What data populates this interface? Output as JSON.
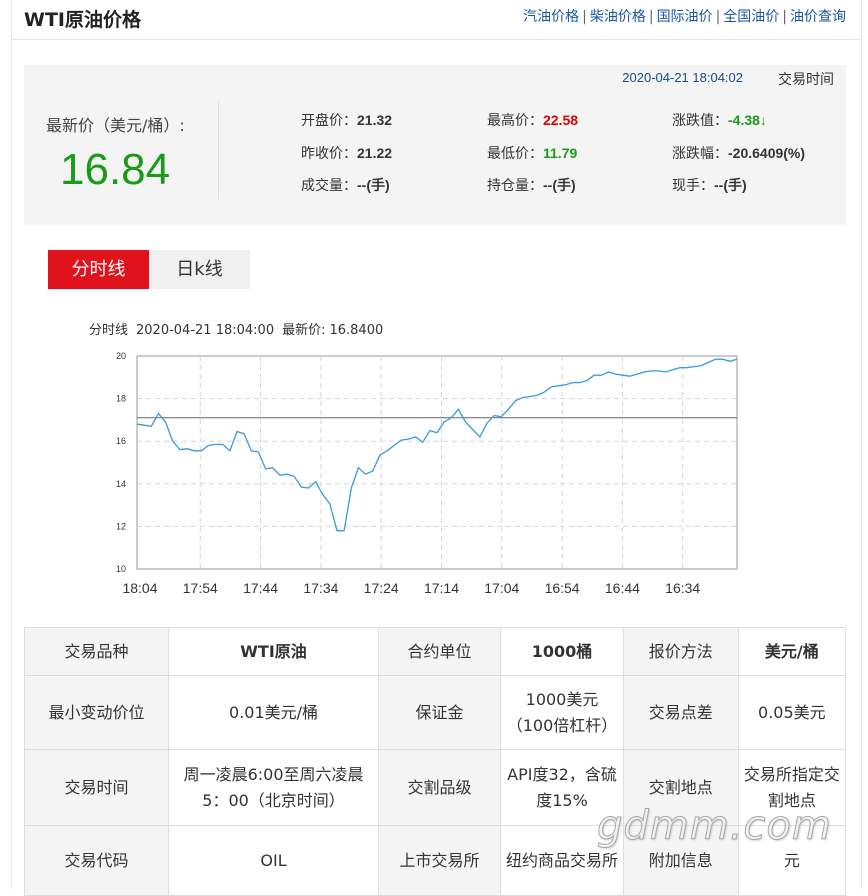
{
  "header": {
    "title": "WTI原油价格",
    "links": [
      "汽油价格",
      "柴油价格",
      "国际油价",
      "全国油价",
      "油价查询"
    ]
  },
  "quote": {
    "datetime": "2020-04-21 18:04:02",
    "time_label": "交易时间",
    "last_label": "最新价（美元/桶）:",
    "last_value": "16.84",
    "stats": {
      "open_label": "开盘价：",
      "open": "21.32",
      "high_label": "最高价：",
      "high": "22.58",
      "change_label": "涨跌值：",
      "change": "-4.38↓",
      "prev_label": "昨收价：",
      "prev": "21.22",
      "low_label": "最低价：",
      "low": "11.79",
      "pct_label": "涨跌幅：",
      "pct": "-20.6409(%)",
      "volume_label": "成交量：",
      "volume": "--(手)",
      "oi_label": "持仓量：",
      "oi": "--(手)",
      "spot_label": "现手：",
      "spot": "--(手)"
    },
    "colors": {
      "up": "#e00000",
      "down": "#1a9a1a"
    }
  },
  "tabs": {
    "intraday": "分时线",
    "daily": "日k线"
  },
  "chart_info": {
    "type_label": "分时线",
    "datetime": "2020-04-21 18:04:00",
    "last_label": "最新价:",
    "last_value": "16.8400"
  },
  "chart_data": {
    "type": "line",
    "title": "",
    "xlabel": "",
    "ylabel": "",
    "x_ticks": [
      "18:04",
      "17:54",
      "17:44",
      "17:34",
      "17:24",
      "17:14",
      "17:04",
      "16:54",
      "16:44",
      "16:34"
    ],
    "ylim": [
      10,
      20
    ],
    "y_ticks": [
      "10",
      "12",
      "14",
      "16",
      "18",
      "20"
    ],
    "reference_line": 17.1,
    "grid": true,
    "series": [
      {
        "values": [
          16.8,
          16.75,
          16.7,
          17.3,
          16.9,
          16.0,
          15.6,
          15.65,
          15.55,
          15.55,
          15.8,
          15.85,
          15.85,
          15.55,
          16.45,
          16.35,
          15.55,
          15.5,
          14.7,
          14.75,
          14.4,
          14.45,
          14.35,
          13.85,
          13.8,
          14.1,
          13.5,
          13.05,
          11.8,
          11.8,
          13.8,
          14.75,
          14.45,
          14.6,
          15.35,
          15.55,
          15.8,
          16.05,
          16.1,
          16.2,
          15.95,
          16.5,
          16.4,
          16.9,
          17.1,
          17.5,
          16.9,
          16.55,
          16.2,
          16.85,
          17.2,
          17.15,
          17.5,
          17.9,
          18.05,
          18.1,
          18.15,
          18.3,
          18.55,
          18.6,
          18.65,
          18.75,
          18.75,
          18.85,
          19.1,
          19.1,
          19.25,
          19.15,
          19.1,
          19.05,
          19.15,
          19.25,
          19.3,
          19.3,
          19.25,
          19.35,
          19.45,
          19.45,
          19.5,
          19.55,
          19.7,
          19.85,
          19.85,
          19.75,
          19.85
        ]
      }
    ]
  },
  "table": [
    [
      {
        "t": "交易品种",
        "h": true
      },
      {
        "t": "WTI原油",
        "b": true
      },
      {
        "t": "合约单位",
        "h": true
      },
      {
        "t": "1000桶",
        "b": true
      },
      {
        "t": "报价方法",
        "h": true
      },
      {
        "t": "美元/桶",
        "b": true
      }
    ],
    [
      {
        "t": "最小变动价位",
        "h": true
      },
      {
        "t": "0.01美元/桶"
      },
      {
        "t": "保证金",
        "h": true
      },
      {
        "t": "1000美元（100倍杠杆）"
      },
      {
        "t": "交易点差",
        "h": true
      },
      {
        "t": "0.05美元"
      }
    ],
    [
      {
        "t": "交易时间",
        "h": true
      },
      {
        "t": "周一凌晨6:00至周六凌晨5：00（北京时间）"
      },
      {
        "t": "交割品级",
        "h": true
      },
      {
        "t": "API度32，含硫度15%"
      },
      {
        "t": "交割地点",
        "h": true
      },
      {
        "t": "交易所指定交割地点"
      }
    ],
    [
      {
        "t": "交易代码",
        "h": true
      },
      {
        "t": "OIL"
      },
      {
        "t": "上市交易所",
        "h": true
      },
      {
        "t": "纽约商品交易所"
      },
      {
        "t": "附加信息",
        "h": true
      },
      {
        "t": "元"
      }
    ]
  ],
  "watermark": "gdmm.com"
}
